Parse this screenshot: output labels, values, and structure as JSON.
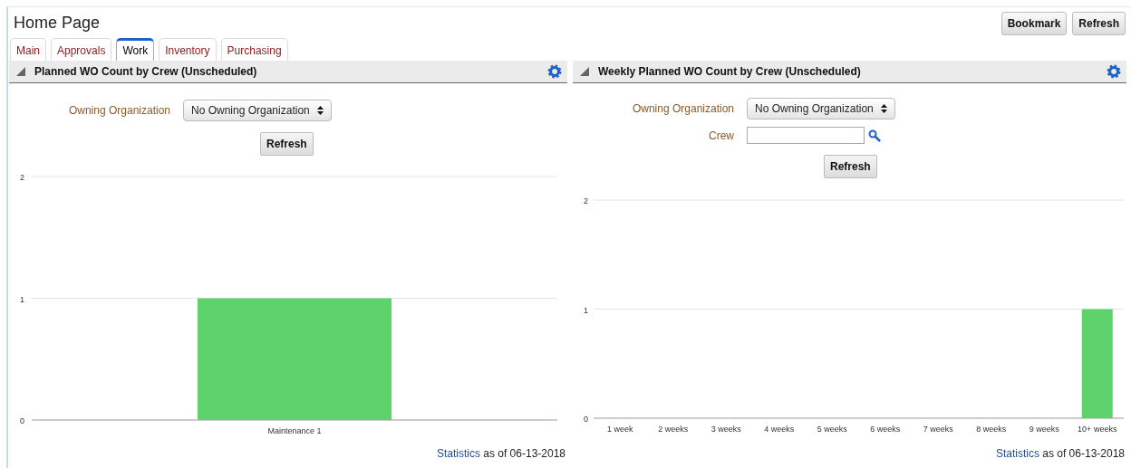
{
  "page": {
    "title": "Home Page",
    "buttons": [
      "Bookmark",
      "Refresh"
    ]
  },
  "tabs": [
    {
      "label": "Main",
      "selected": false
    },
    {
      "label": "Approvals",
      "selected": false
    },
    {
      "label": "Work",
      "selected": true
    },
    {
      "label": "Inventory",
      "selected": false
    },
    {
      "label": "Purchasing",
      "selected": false
    }
  ],
  "panels": [
    {
      "title": "Planned WO Count by Crew (Unscheduled)",
      "fields": [
        {
          "kind": "select",
          "label": "Owning Organization",
          "value": "No Owning Organization"
        }
      ],
      "button": "Refresh",
      "chart_data": {
        "type": "bar",
        "categories": [
          "Maintenance 1"
        ],
        "values": [
          1
        ],
        "ylim": [
          0,
          2
        ],
        "yticks": [
          0,
          1,
          2
        ]
      },
      "footer": {
        "link": "Statistics",
        "text": "as of 06-13-2018"
      }
    },
    {
      "title": "Weekly Planned WO Count by Crew (Unscheduled)",
      "fields": [
        {
          "kind": "select",
          "label": "Owning Organization",
          "value": "No Owning Organization"
        },
        {
          "kind": "lookup",
          "label": "Crew"
        }
      ],
      "button": "Refresh",
      "chart_data": {
        "type": "bar",
        "categories": [
          "1 week",
          "2 weeks",
          "3 weeks",
          "4 weeks",
          "5 weeks",
          "6 weeks",
          "7 weeks",
          "8 weeks",
          "9 weeks",
          "10+ weeks"
        ],
        "values": [
          0,
          0,
          0,
          0,
          0,
          0,
          0,
          0,
          0,
          1
        ],
        "ylim": [
          0,
          2
        ],
        "yticks": [
          0,
          1,
          2
        ]
      },
      "footer": {
        "link": "Statistics",
        "text": "as of 06-13-2018"
      }
    }
  ]
}
